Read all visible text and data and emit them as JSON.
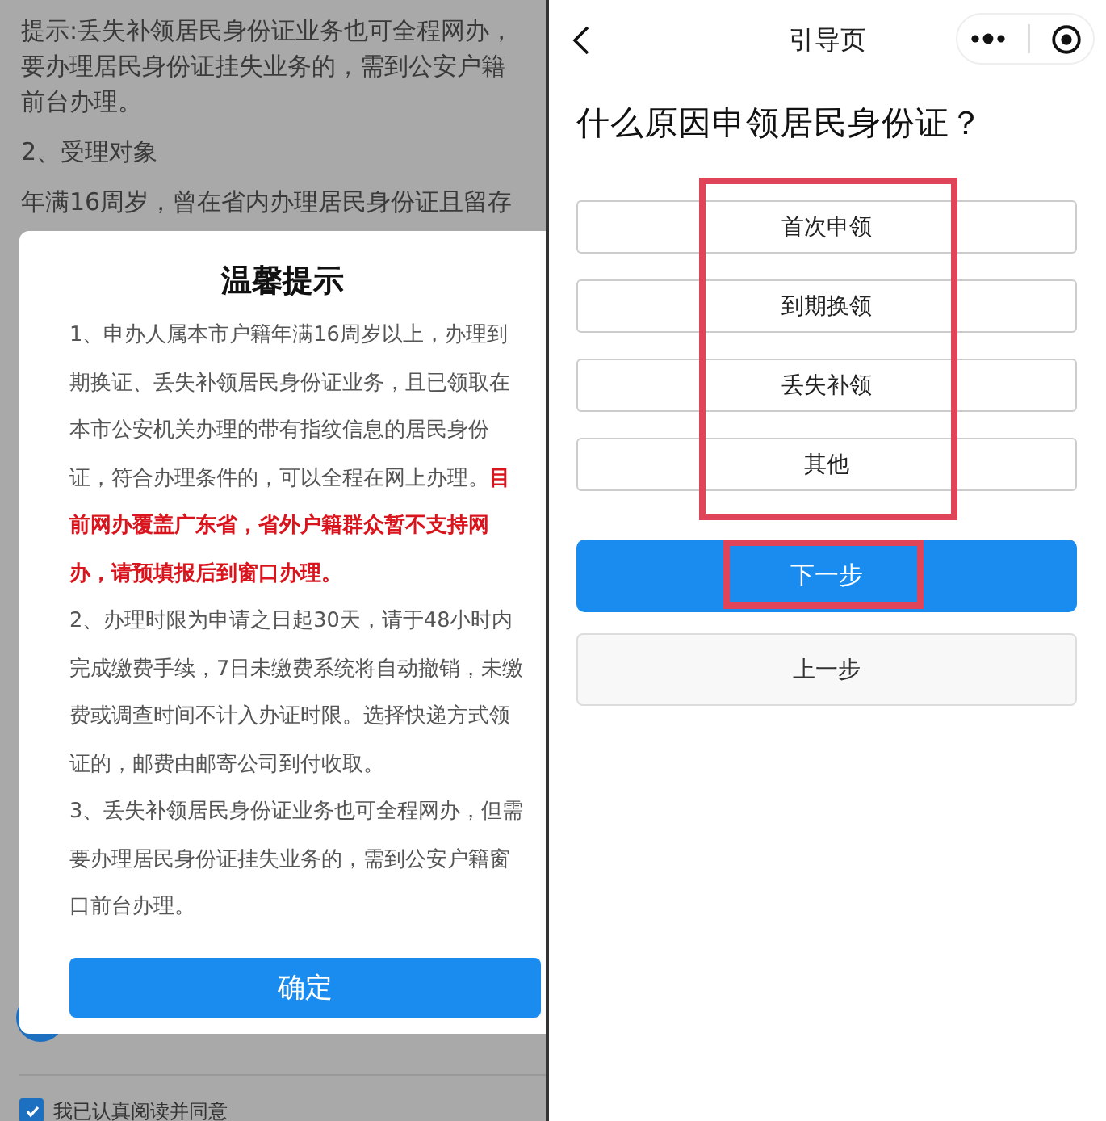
{
  "background_page": {
    "lines": [
      "提示:丢失补领居民身份证业务也可全程网办，",
      "要办理居民身份证挂失业务的，需到公安户籍",
      "前台办理。",
      "2、受理对象",
      "年满16周岁，曾在省内办理居民身份证且留存"
    ],
    "agreement": {
      "label": "我已认真阅读并同意",
      "checked": true
    }
  },
  "dialog": {
    "title": "温馨提示",
    "paragraphs": [
      "1、申办人属本市户籍年满16周岁以上，办理到期换证、丢失补领居民身份证业务，且已领取在本市公安机关办理的带有指纹信息的居民身份证，符合办理条件的，可以全程在网上办理。**目前网办覆盖广东省，省外户籍群众暂不支持网办，请预填报后到窗口办理。**",
      "2、办理时限为申请之日起30天，请于48小时内完成缴费手续，7日未缴费系统将自动撤销，未缴费或调查时间不计入办证时限。选择快递方式领证的，邮费由邮寄公司到付收取。",
      "3、丢失补领居民身份证业务也可全程网办，但需要办理居民身份证挂失业务的，需到公安户籍窗口前台办理。"
    ],
    "confirm_button": "确定"
  },
  "guide_page": {
    "title": "引导页",
    "question": "什么原因申领居民身份证？",
    "options": [
      {
        "label": "首次申领"
      },
      {
        "label": "到期换领"
      },
      {
        "label": "丢失补领"
      },
      {
        "label": "其他"
      }
    ],
    "next_button": "下一步",
    "prev_button": "上一步"
  }
}
